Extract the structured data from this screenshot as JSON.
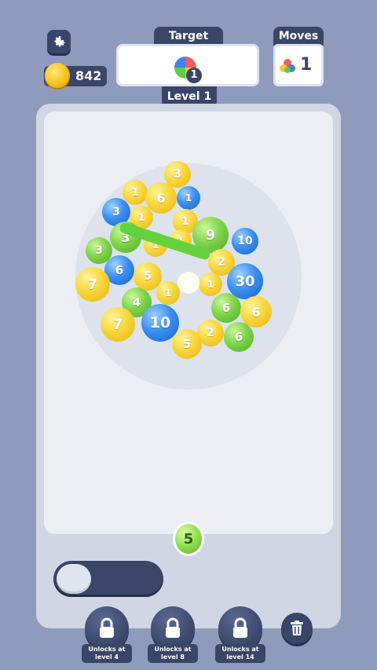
{
  "header": {
    "settings_icon": "gear-icon",
    "coins": "842",
    "coin_icon": "coin-icon",
    "target_label": "Target",
    "target_count": "1",
    "level_label": "Level 1",
    "moves_label": "Moves",
    "moves_count": "1"
  },
  "board": {
    "balls": [
      {
        "color": "yellow",
        "value": "3"
      },
      {
        "color": "yellow",
        "value": "1"
      },
      {
        "color": "yellow",
        "value": "6"
      },
      {
        "color": "blue",
        "value": "1"
      },
      {
        "color": "blue",
        "value": "3"
      },
      {
        "color": "yellow",
        "value": "1"
      },
      {
        "color": "yellow",
        "value": "1"
      },
      {
        "color": "green",
        "value": "9"
      },
      {
        "color": "blue",
        "value": "10"
      },
      {
        "color": "green",
        "value": "3"
      },
      {
        "color": "green",
        "value": "3"
      },
      {
        "color": "yellow",
        "value": "1"
      },
      {
        "color": "blue",
        "value": "6"
      },
      {
        "color": "yellow",
        "value": "5"
      },
      {
        "color": "yellow",
        "value": "2"
      },
      {
        "color": "yellow",
        "value": "7"
      },
      {
        "color": "blue",
        "value": "30"
      },
      {
        "color": "yellow",
        "value": "1"
      },
      {
        "color": "yellow",
        "value": "1"
      },
      {
        "color": "green",
        "value": "4"
      },
      {
        "color": "yellow",
        "value": "1"
      },
      {
        "color": "green",
        "value": "6"
      },
      {
        "color": "yellow",
        "value": "6"
      },
      {
        "color": "yellow",
        "value": "7"
      },
      {
        "color": "blue",
        "value": "10"
      },
      {
        "color": "yellow",
        "value": "2"
      },
      {
        "color": "green",
        "value": "6"
      },
      {
        "color": "yellow",
        "value": "5"
      }
    ],
    "next_ball": {
      "color": "green",
      "value": "5"
    }
  },
  "footer": {
    "boosters": [
      {
        "label": "Unlocks at level 4",
        "icon": "lock-icon"
      },
      {
        "label": "Unlocks at level 8",
        "icon": "lock-icon"
      },
      {
        "label": "Unlocks at level 14",
        "icon": "lock-icon"
      }
    ],
    "trash_icon": "trash-icon"
  },
  "colors": {
    "background": "#8f9bbd",
    "panel": "#3a4568",
    "yellow": "#f8d63a",
    "green": "#7fd44a",
    "blue": "#3a8ff0"
  }
}
